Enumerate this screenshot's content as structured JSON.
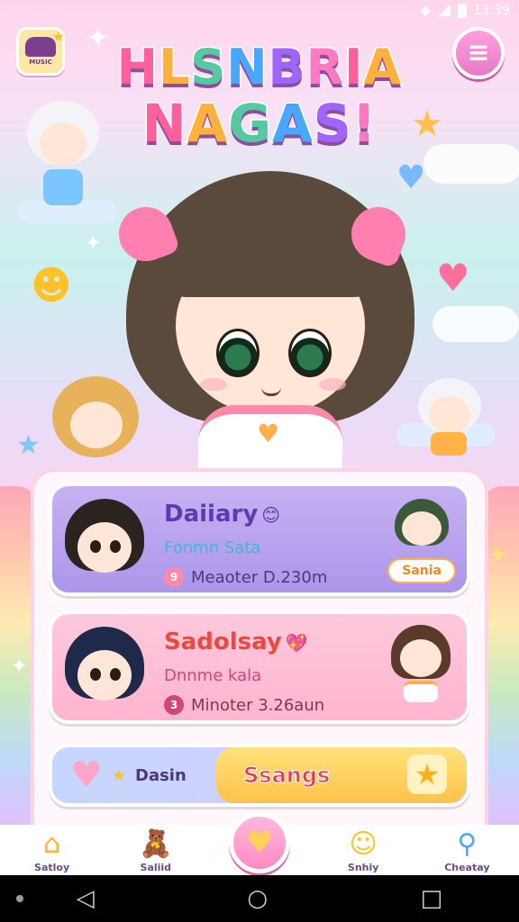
{
  "status_bar": {
    "time": "13:39"
  },
  "header": {
    "logo_text": "MUSIC",
    "title_line1": "HLSNBRIA",
    "title_line2": "NAGAS!",
    "menu_icon": "menu-icon"
  },
  "cards": [
    {
      "name": "Daiiary",
      "emoji": "😊",
      "subtitle": "Fonmn Sata",
      "meta_icon": "9",
      "meta": "Meaoter D.230m",
      "tag": "Sania"
    },
    {
      "name": "Sadolsay",
      "emoji": "💖",
      "subtitle": "Dnnme kala",
      "meta_icon": "3",
      "meta": "Minoter 3.26aun",
      "tag": ""
    }
  ],
  "action_bar": {
    "left_label": "Dasin",
    "right_label": "Ssangs"
  },
  "bottom_nav": [
    {
      "label": "Satloy",
      "icon": "home-icon",
      "glyph": "⌂"
    },
    {
      "label": "Saliid",
      "icon": "bear-icon",
      "glyph": "🧸"
    },
    {
      "label": "Snhiy",
      "icon": "smile-icon",
      "glyph": "☺"
    },
    {
      "label": "Cheatay",
      "icon": "search-icon",
      "glyph": "⚲"
    }
  ],
  "colors": {
    "accent_pink": "#ff8ac4",
    "card_purple": "#ad96ea",
    "card_pink": "#ffb4cf",
    "action_yellow": "#ffc24a"
  }
}
